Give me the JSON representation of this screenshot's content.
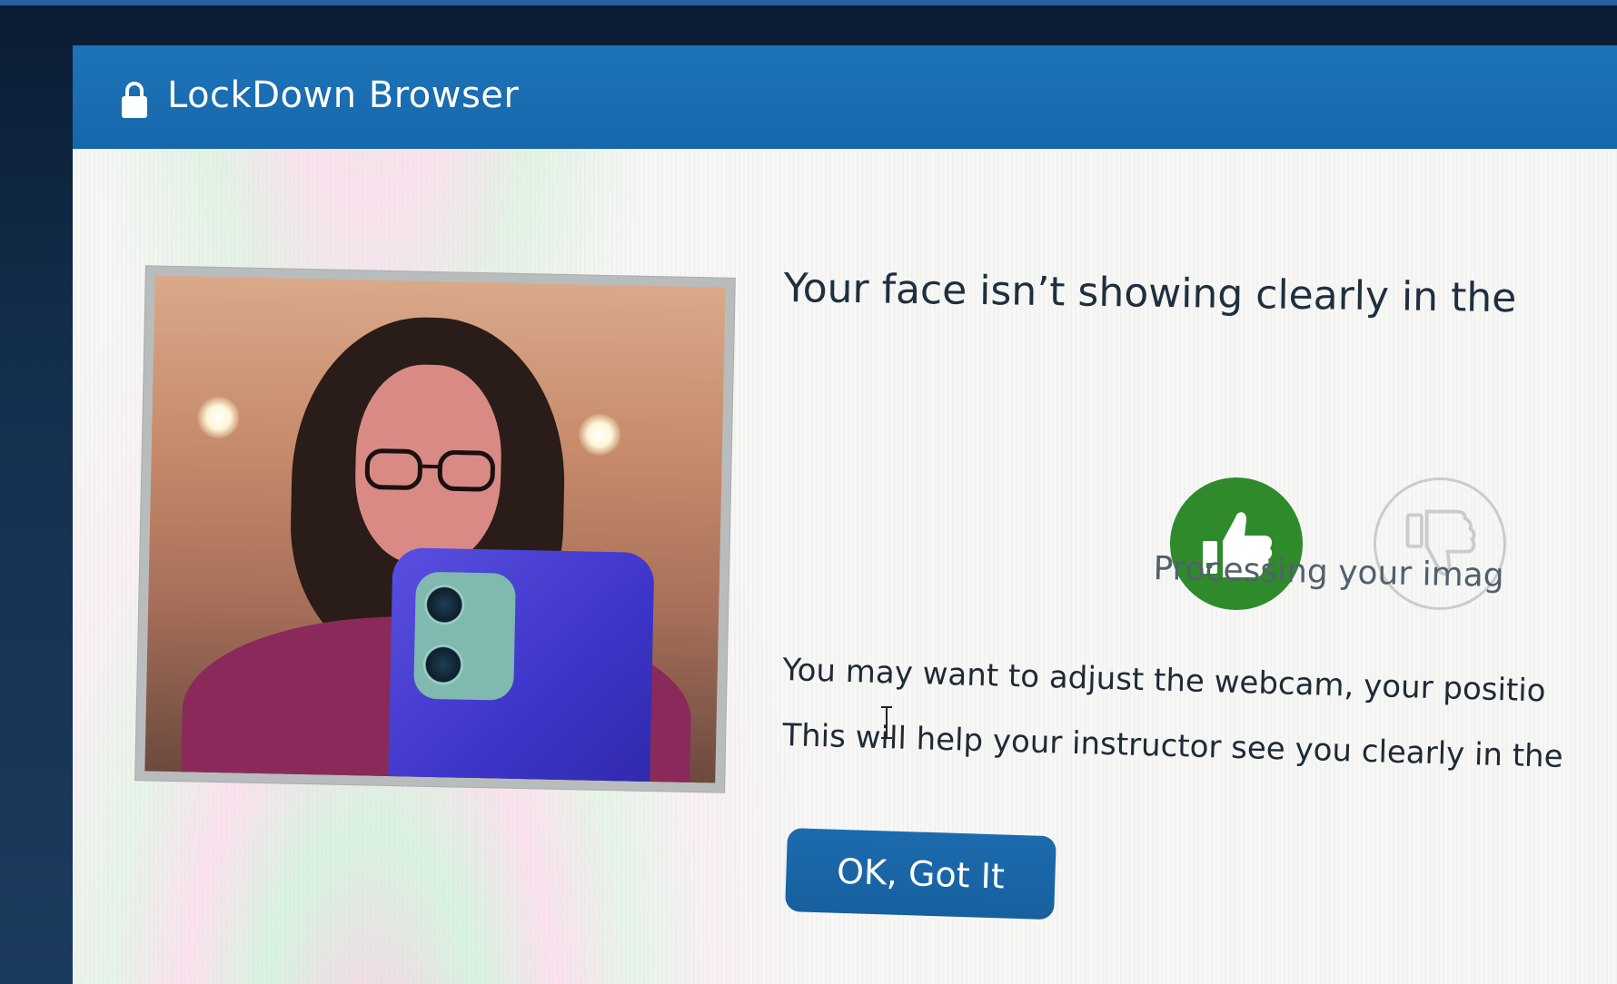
{
  "window": {
    "title": "LockDown Browser",
    "title_icon": "lock-icon"
  },
  "dialog": {
    "heading": "Your face isn’t showing clearly in the",
    "feedback": {
      "thumbs_up_icon": "thumbs-up-icon",
      "thumbs_down_icon": "thumbs-down-icon",
      "selected": "thumbs-up"
    },
    "status_text": "Processing your imag",
    "message_line_1": "You may want to adjust the webcam, your positio",
    "message_line_2": "This will help your instructor see you clearly in the",
    "ok_button_label": "OK, Got It"
  },
  "colors": {
    "titlebar": "#1e73b7",
    "thumbs_up_bg": "#2f8a2c",
    "button_bg": "#1c6bae"
  }
}
